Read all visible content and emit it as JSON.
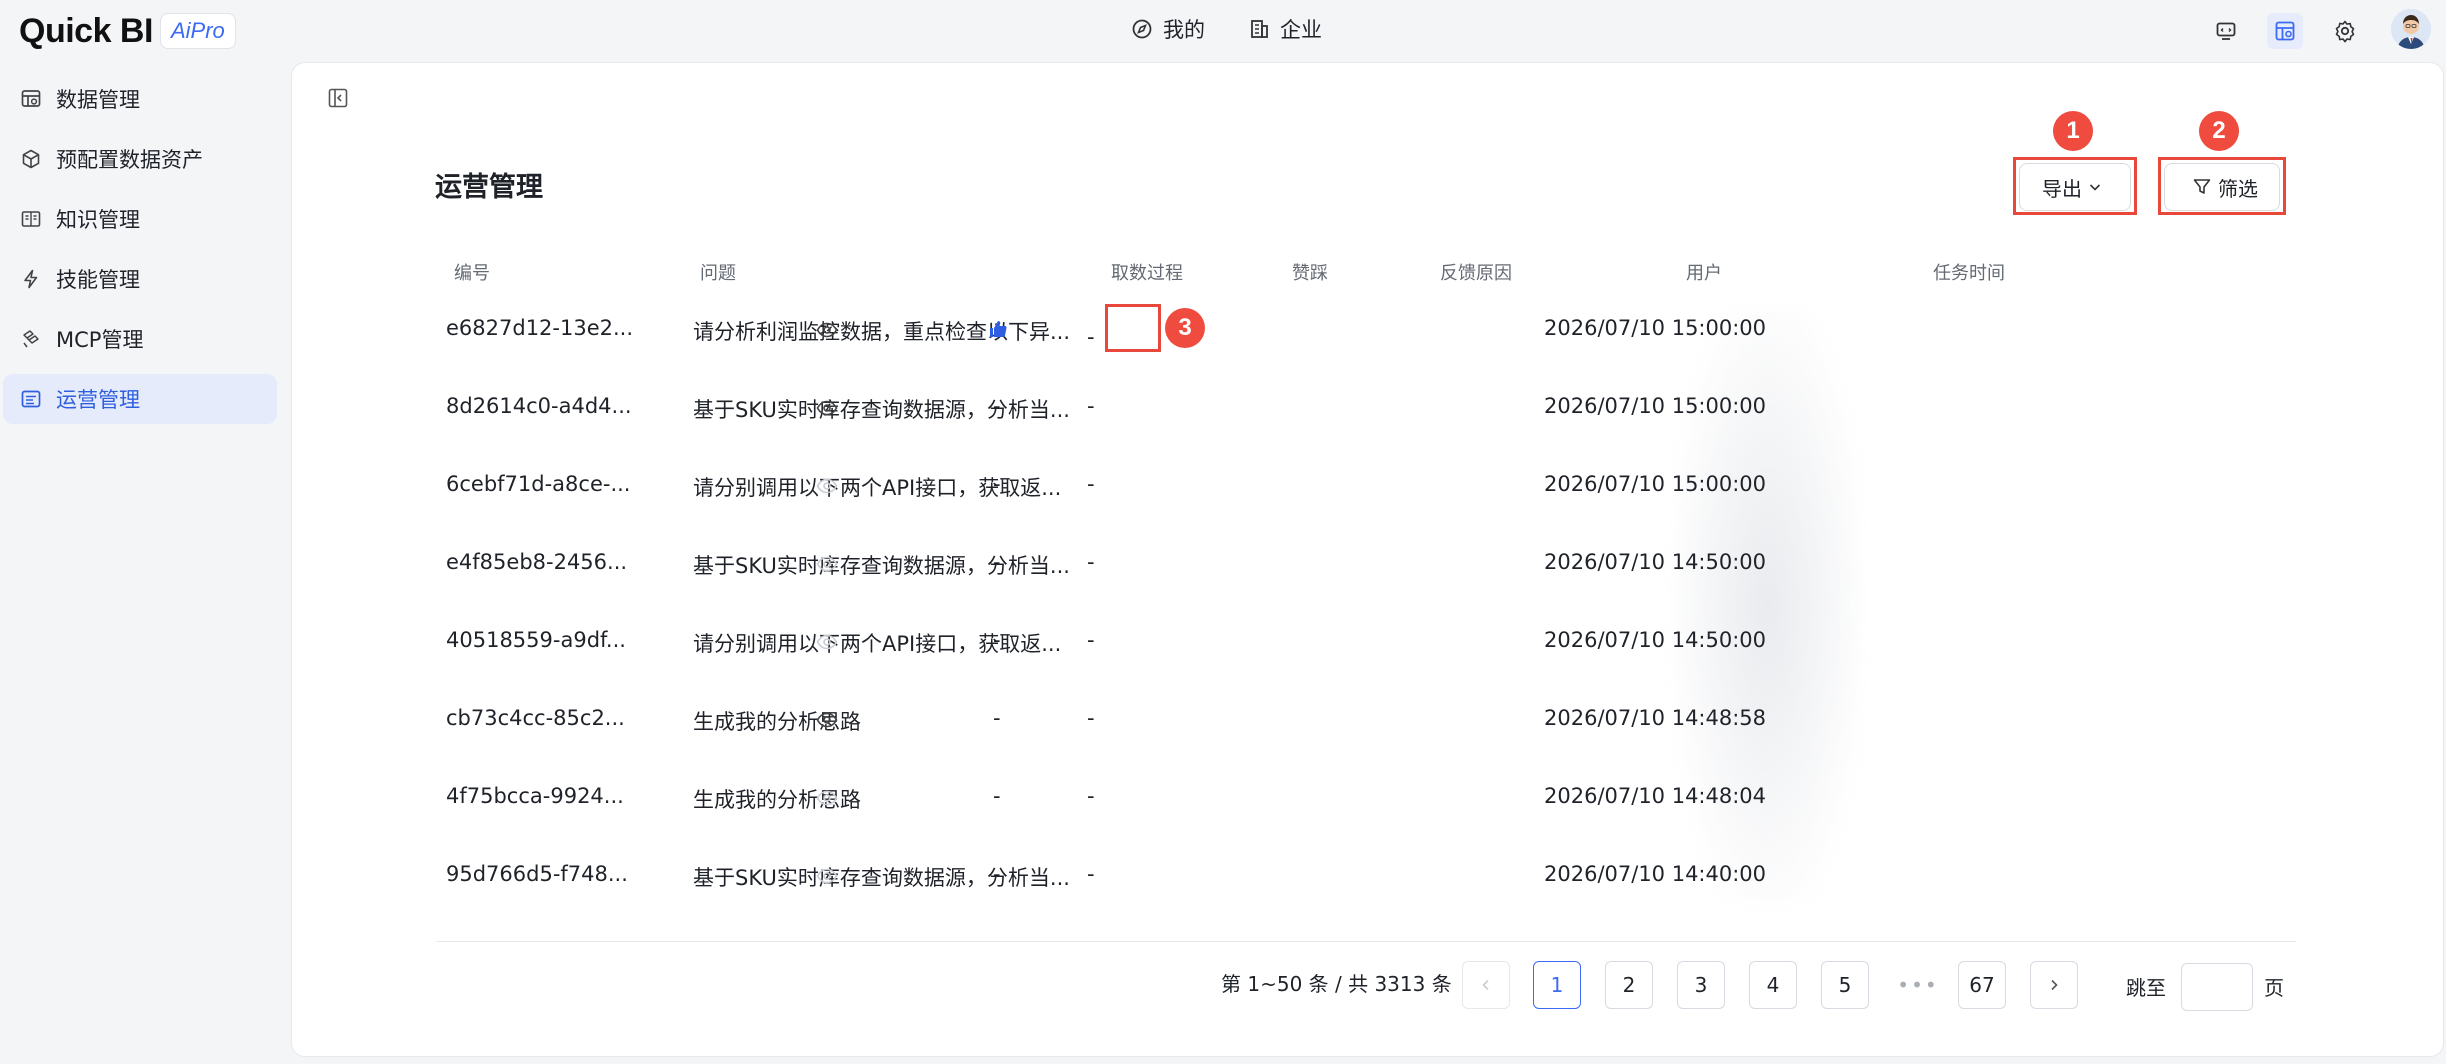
{
  "app": {
    "logo": "Quick BI",
    "badge": "AiPro"
  },
  "top_nav": [
    {
      "label": "我的",
      "icon": "compass-icon"
    },
    {
      "label": "企业",
      "icon": "building-icon"
    }
  ],
  "top_icons": [
    "screen-icon",
    "dashboard-icon",
    "settings-icon",
    "user-avatar"
  ],
  "sidebar": {
    "items": [
      {
        "label": "数据管理",
        "icon": "data-icon",
        "active": false
      },
      {
        "label": "预配置数据资产",
        "icon": "cube-icon",
        "active": false
      },
      {
        "label": "知识管理",
        "icon": "book-icon",
        "active": false
      },
      {
        "label": "技能管理",
        "icon": "lightning-icon",
        "active": false
      },
      {
        "label": "MCP管理",
        "icon": "mcp-icon",
        "active": false
      },
      {
        "label": "运营管理",
        "icon": "operations-icon",
        "active": true
      }
    ]
  },
  "main": {
    "title": "运营管理",
    "export_label": "导出",
    "filter_label": "筛选",
    "callouts": [
      "1",
      "2",
      "3"
    ]
  },
  "table": {
    "columns": [
      "编号",
      "问题",
      "取数过程",
      "赞踩",
      "反馈原因",
      "用户",
      "任务时间"
    ],
    "rows": [
      {
        "id": "e6827d12-13e2...",
        "question": "请分析利润监控数据，重点检查以下异...",
        "process": "active",
        "vote": "like",
        "reason": "-",
        "time": "2026/07/10 15:00:00"
      },
      {
        "id": "8d2614c0-a4d4...",
        "question": "基于SKU实时库存查询数据源，分析当...",
        "process": "active",
        "vote": "-",
        "reason": "-",
        "time": "2026/07/10 15:00:00"
      },
      {
        "id": "6cebf71d-a8ce-...",
        "question": "请分别调用以下两个API接口，获取返...",
        "process": "disabled",
        "vote": "-",
        "reason": "-",
        "time": "2026/07/10 15:00:00"
      },
      {
        "id": "e4f85eb8-2456...",
        "question": "基于SKU实时库存查询数据源，分析当...",
        "process": "disabled",
        "vote": "-",
        "reason": "-",
        "time": "2026/07/10 14:50:00"
      },
      {
        "id": "40518559-a9df...",
        "question": "请分别调用以下两个API接口，获取返...",
        "process": "disabled",
        "vote": "-",
        "reason": "-",
        "time": "2026/07/10 14:50:00"
      },
      {
        "id": "cb73c4cc-85c2...",
        "question": "生成我的分析思路",
        "process": "active",
        "vote": "-",
        "reason": "-",
        "time": "2026/07/10 14:48:58"
      },
      {
        "id": "4f75bcca-9924...",
        "question": "生成我的分析思路",
        "process": "disabled",
        "vote": "-",
        "reason": "-",
        "time": "2026/07/10 14:48:04"
      },
      {
        "id": "95d766d5-f748...",
        "question": "基于SKU实时库存查询数据源，分析当...",
        "process": "disabled",
        "vote": "-",
        "reason": "-",
        "time": "2026/07/10 14:40:00"
      }
    ]
  },
  "pagination": {
    "summary": "第 1~50 条 / 共 3313 条",
    "pages": [
      "1",
      "2",
      "3",
      "4",
      "5",
      "•••",
      "67"
    ],
    "current": "1",
    "jump_label": "跳至",
    "page_suffix": "页"
  },
  "colors": {
    "accent": "#3d6af5",
    "callout": "#ef4b3f",
    "sidebar_active_bg": "#e5ebfb"
  }
}
